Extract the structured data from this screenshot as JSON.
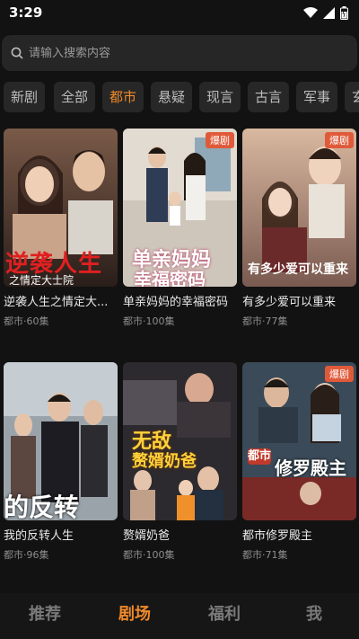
{
  "status": {
    "time": "3:29",
    "icons": [
      "wifi-icon",
      "signal-icon",
      "battery-icon"
    ]
  },
  "search": {
    "placeholder": "请输入搜索内容",
    "icon": "search-icon"
  },
  "categories": [
    {
      "label": "新剧",
      "active": false
    },
    {
      "label": "全部",
      "active": false
    },
    {
      "label": "都市",
      "active": true
    },
    {
      "label": "悬疑",
      "active": false
    },
    {
      "label": "现言",
      "active": false
    },
    {
      "label": "古言",
      "active": false
    },
    {
      "label": "军事",
      "active": false
    },
    {
      "label": "玄",
      "active": false
    }
  ],
  "dramas": [
    {
      "title": "逆袭人生之情定大...",
      "meta": "都市·60集",
      "badge": "",
      "poster_text": "逆袭人生",
      "poster_sub": "之情定大士院"
    },
    {
      "title": "单亲妈妈的幸福密码",
      "meta": "都市·100集",
      "badge": "爆剧",
      "poster_text": "单亲妈妈",
      "poster_sub": "幸福密码"
    },
    {
      "title": "有多少爱可以重来",
      "meta": "都市·77集",
      "badge": "爆剧",
      "poster_text": "有多少爱可以重来",
      "poster_sub": ""
    },
    {
      "title": "我的反转人生",
      "meta": "都市·96集",
      "badge": "",
      "poster_text": "的反转",
      "poster_sub": ""
    },
    {
      "title": "赘婿奶爸",
      "meta": "都市·100集",
      "badge": "",
      "poster_text": "无敌",
      "poster_sub": "赘婿奶爸"
    },
    {
      "title": "都市修罗殿主",
      "meta": "都市·71集",
      "badge": "爆剧",
      "poster_text": "修罗殿主",
      "poster_sub": "都市"
    }
  ],
  "bottom_nav": [
    {
      "label": "推荐",
      "active": false
    },
    {
      "label": "剧场",
      "active": true
    },
    {
      "label": "福利",
      "active": false
    },
    {
      "label": "我",
      "active": false
    }
  ],
  "colors": {
    "accent": "#f08a2a",
    "badge": "#e05a3a",
    "background": "#121212"
  }
}
